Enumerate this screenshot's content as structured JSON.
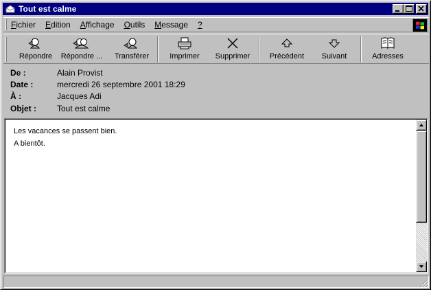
{
  "window": {
    "title": "Tout est calme",
    "title_icon": "envelope-icon"
  },
  "menu": {
    "items": [
      {
        "label": "Fichier",
        "mnemonic": "F",
        "rest": "ichier"
      },
      {
        "label": "Edition",
        "mnemonic": "E",
        "rest": "dition"
      },
      {
        "label": "Affichage",
        "mnemonic": "A",
        "rest": "ffichage"
      },
      {
        "label": "Outils",
        "mnemonic": "O",
        "rest": "utils"
      },
      {
        "label": "Message",
        "mnemonic": "M",
        "rest": "essage"
      },
      {
        "label": "?",
        "mnemonic": "?",
        "rest": ""
      }
    ]
  },
  "toolbar": {
    "reply": "Répondre",
    "reply_all": "Répondre ...",
    "forward": "Transférer",
    "print": "Imprimer",
    "delete": "Supprimer",
    "previous": "Précédent",
    "next": "Suivant",
    "addresses": "Adresses"
  },
  "headers": {
    "from_label": "De :",
    "from_value": "Alain Provist",
    "date_label": "Date :",
    "date_value": "mercredi 26 septembre 2001 18:29",
    "to_label": "À :",
    "to_value": "Jacques Adi",
    "subject_label": "Objet :",
    "subject_value": "Tout est calme"
  },
  "message": {
    "lines": [
      "Les vacances se passent bien.",
      "A bientôt."
    ]
  },
  "colors": {
    "titlebar": "#000080",
    "face": "#c0c0c0"
  }
}
